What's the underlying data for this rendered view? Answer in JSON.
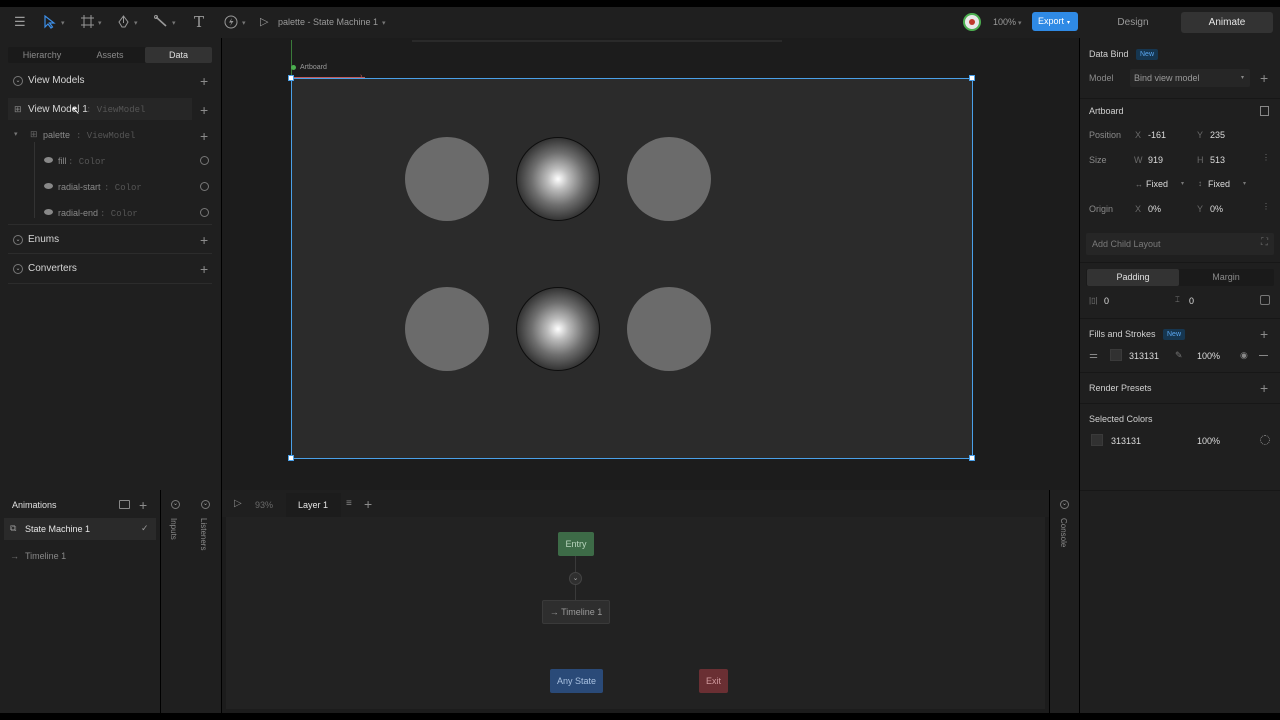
{
  "toolbar": {
    "file_title": "palette - State Machine 1",
    "zoom": "100%",
    "export_label": "Export",
    "mode_tabs": [
      "Design",
      "Animate"
    ],
    "active_mode": "Animate"
  },
  "left_panel": {
    "tabs": [
      "Hierarchy",
      "Assets",
      "Data"
    ],
    "active_tab": "Data",
    "sections": {
      "view_models": "View Models",
      "enums": "Enums",
      "converters": "Converters"
    },
    "view_model_row": {
      "name": "View Model 1",
      "type": ": ViewModel"
    },
    "palette_row": {
      "name": "palette",
      "type": ": ViewModel"
    },
    "properties": [
      {
        "name": "fill",
        "type": ": Color"
      },
      {
        "name": "radial-start",
        "type": ": Color"
      },
      {
        "name": "radial-end",
        "type": ": Color"
      }
    ]
  },
  "canvas": {
    "artboard_label": "Artboard",
    "background_color": "#2b2b2b"
  },
  "right_panel": {
    "data_bind": {
      "title": "Data Bind",
      "badge": "New",
      "model_label": "Model",
      "model_value": "Bind view model"
    },
    "artboard": {
      "title": "Artboard",
      "position_label": "Position",
      "x_axis": "X",
      "x": "-161",
      "y_axis": "Y",
      "y": "235",
      "size_label": "Size",
      "w_axis": "W",
      "w": "919",
      "h_axis": "H",
      "h": "513",
      "w_mode": "Fixed",
      "h_mode": "Fixed",
      "origin_label": "Origin",
      "ox_axis": "X",
      "ox": "0%",
      "oy_axis": "Y",
      "oy": "0%"
    },
    "add_child_layout": "Add Child Layout",
    "spacing_tabs": [
      "Padding",
      "Margin"
    ],
    "padding_h": "0",
    "padding_v": "0",
    "fills": {
      "title": "Fills and Strokes",
      "badge": "New",
      "hex": "313131",
      "opacity": "100%"
    },
    "render_presets": "Render Presets",
    "selected_colors": {
      "title": "Selected Colors",
      "hex": "313131",
      "opacity": "100%"
    }
  },
  "animations": {
    "title": "Animations",
    "items": [
      "State Machine 1",
      "Timeline 1"
    ],
    "side_tabs": [
      "Inputs",
      "Listeners"
    ]
  },
  "graph": {
    "zoom": "93%",
    "layer": "Layer 1",
    "nodes": {
      "entry": "Entry",
      "timeline": "Timeline 1",
      "any_state": "Any State",
      "exit": "Exit"
    }
  },
  "console_label": "Console"
}
